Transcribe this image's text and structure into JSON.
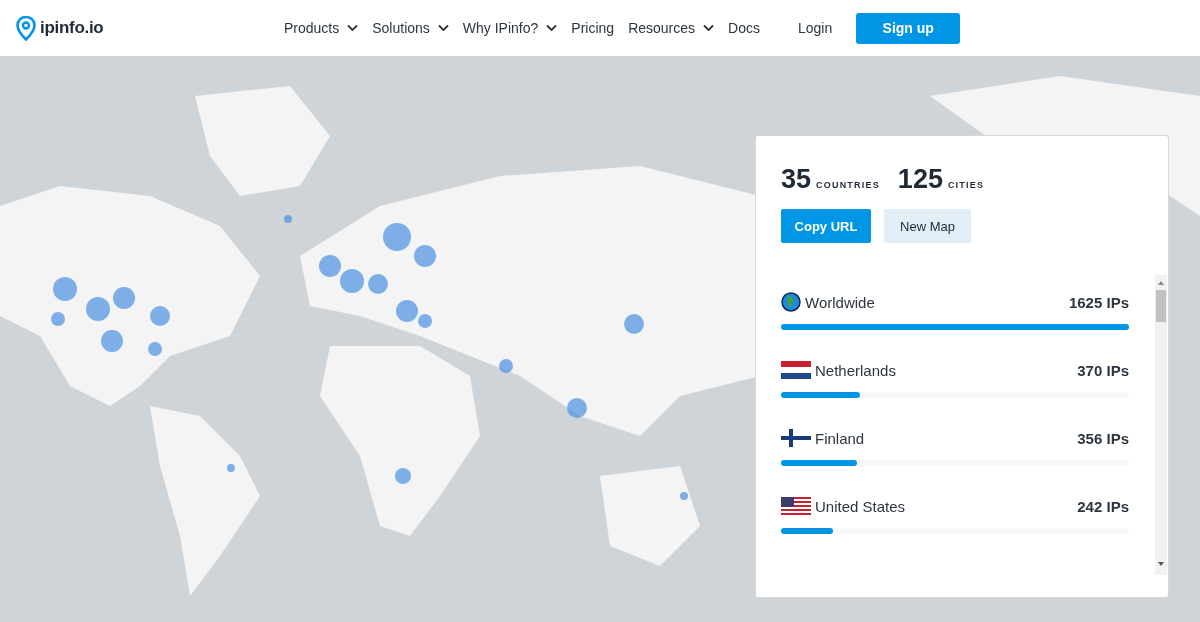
{
  "header": {
    "logo": "ipinfo.io",
    "nav": [
      {
        "label": "Products",
        "dropdown": true
      },
      {
        "label": "Solutions",
        "dropdown": true
      },
      {
        "label": "Why IPinfo?",
        "dropdown": true
      },
      {
        "label": "Pricing",
        "dropdown": false
      },
      {
        "label": "Resources",
        "dropdown": true
      },
      {
        "label": "Docs",
        "dropdown": false
      }
    ],
    "login": "Login",
    "signup": "Sign up"
  },
  "panel": {
    "stats": [
      {
        "count": "35",
        "unit": "COUNTRIES"
      },
      {
        "count": "125",
        "unit": "CITIES"
      }
    ],
    "buttons": [
      {
        "label": "Copy URL",
        "kind": "primary"
      },
      {
        "label": "New Map",
        "kind": "secondary"
      }
    ],
    "rows": [
      {
        "kind": "globe",
        "name": "Worldwide",
        "ips": "1625 IPs",
        "level": 1.0
      },
      {
        "kind": "nl",
        "name": "Netherlands",
        "ips": "370 IPs",
        "level": 0.228
      },
      {
        "kind": "fi",
        "name": "Finland",
        "ips": "356 IPs",
        "level": 0.219
      },
      {
        "kind": "us",
        "name": "United States",
        "ips": "242 IPs",
        "level": 0.149
      }
    ]
  }
}
